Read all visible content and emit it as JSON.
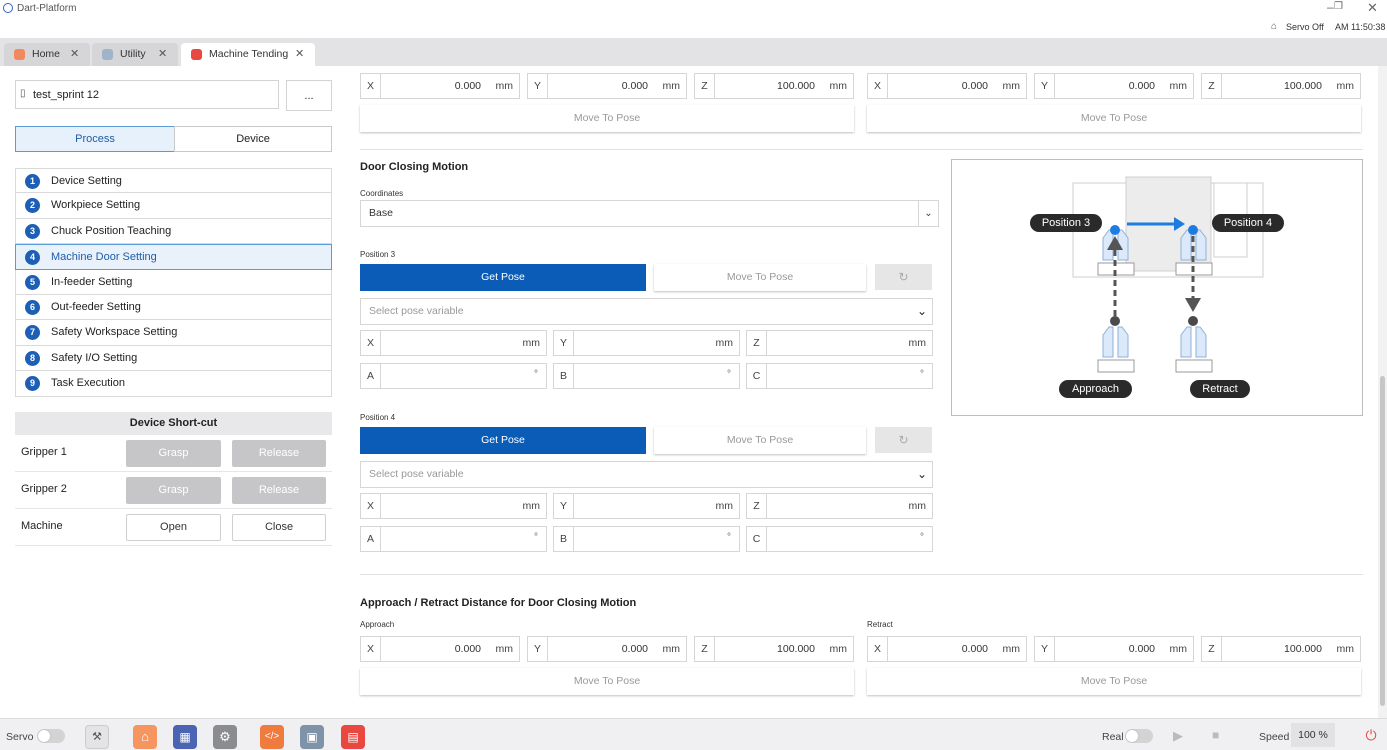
{
  "app": {
    "title": "Dart-Platform",
    "status_text": "Servo Off",
    "time": "AM 11:50:38"
  },
  "tabs": [
    {
      "label": "Home"
    },
    {
      "label": "Utility"
    },
    {
      "label": "Machine Tending"
    }
  ],
  "left": {
    "task_name": "test_sprint 12",
    "more_label": "...",
    "segments": {
      "process": "Process",
      "device": "Device"
    },
    "menu": [
      {
        "num": "1",
        "label": "Device Setting"
      },
      {
        "num": "2",
        "label": "Workpiece Setting"
      },
      {
        "num": "3",
        "label": "Chuck Position Teaching"
      },
      {
        "num": "4",
        "label": "Machine Door Setting"
      },
      {
        "num": "5",
        "label": "In-feeder Setting"
      },
      {
        "num": "6",
        "label": "Out-feeder Setting"
      },
      {
        "num": "7",
        "label": "Safety Workspace Setting"
      },
      {
        "num": "8",
        "label": "Safety I/O Setting"
      },
      {
        "num": "9",
        "label": "Task Execution"
      }
    ],
    "shortcut": {
      "title": "Device Short-cut",
      "rows": [
        {
          "label": "Gripper 1",
          "b1": "Grasp",
          "b2": "Release"
        },
        {
          "label": "Gripper 2",
          "b1": "Grasp",
          "b2": "Release"
        },
        {
          "label": "Machine",
          "b1": "Open",
          "b2": "Close"
        }
      ]
    }
  },
  "top_rows": {
    "left": {
      "x": "0.000",
      "y": "0.000",
      "z": "100.000",
      "unit": "mm",
      "move": "Move To Pose"
    },
    "right": {
      "x": "0.000",
      "y": "0.000",
      "z": "100.000",
      "unit": "mm",
      "move": "Move To Pose"
    }
  },
  "door_closing": {
    "title": "Door Closing Motion",
    "coord_label": "Coordinates",
    "coord_value": "Base",
    "pos3": {
      "label": "Position 3",
      "get": "Get Pose",
      "move": "Move To Pose",
      "placeholder": "Select pose variable",
      "unit_len": "mm",
      "unit_ang": "°"
    },
    "pos4": {
      "label": "Position 4",
      "get": "Get Pose",
      "move": "Move To Pose",
      "placeholder": "Select pose variable",
      "unit_len": "mm",
      "unit_ang": "°"
    }
  },
  "axes": {
    "x": "X",
    "y": "Y",
    "z": "Z",
    "a": "A",
    "b": "B",
    "c": "C"
  },
  "diagram": {
    "p3": "Position 3",
    "p4": "Position 4",
    "approach": "Approach",
    "retract": "Retract"
  },
  "approach_retract": {
    "title": "Approach / Retract Distance for Door Closing Motion",
    "approach_label": "Approach",
    "retract_label": "Retract",
    "approach": {
      "x": "0.000",
      "y": "0.000",
      "z": "100.000",
      "unit": "mm",
      "move": "Move To Pose"
    },
    "retract": {
      "x": "0.000",
      "y": "0.000",
      "z": "100.000",
      "unit": "mm",
      "move": "Move To Pose"
    }
  },
  "bottom": {
    "servo": "Servo",
    "real": "Real",
    "speed": "Speed",
    "speed_value": "100 %"
  }
}
